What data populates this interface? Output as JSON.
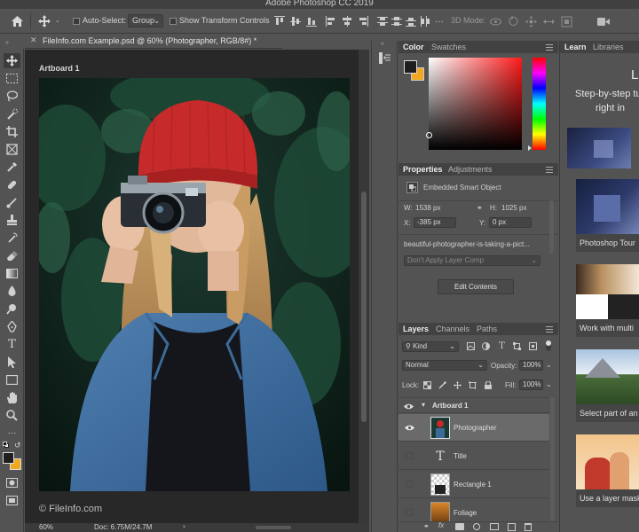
{
  "app": {
    "title": "Adobe Photoshop CC 2019"
  },
  "options_bar": {
    "auto_select_label": "Auto-Select:",
    "auto_select_value": "Group",
    "show_transform_label": "Show Transform Controls",
    "mode_3d_label": "3D Mode:"
  },
  "document": {
    "tab_title": "FileInfo.com Example.psd @ 60% (Photographer, RGB/8#) *",
    "artboard_label": "Artboard 1",
    "watermark": "© FileInfo.com",
    "zoom": "60%",
    "doc_size": "Doc: 6.75M/24.7M"
  },
  "color_panel": {
    "tabs": [
      "Color",
      "Swatches"
    ],
    "foreground": "#1e1e1e",
    "background": "#f0a820"
  },
  "properties_panel": {
    "tabs": [
      "Properties",
      "Adjustments"
    ],
    "object_type": "Embedded Smart Object",
    "w_label": "W:",
    "w_value": "1538 px",
    "h_label": "H:",
    "h_value": "1025 px",
    "x_label": "X:",
    "x_value": "-385 px",
    "y_label": "Y:",
    "y_value": "0 px",
    "filename": "beautiful-photographer-is-taking-a-pict...",
    "layer_comp": "Don't Apply Layer Comp",
    "edit_button": "Edit Contents"
  },
  "layers_panel": {
    "tabs": [
      "Layers",
      "Channels",
      "Paths"
    ],
    "filter_kind": "Kind",
    "blend_mode": "Normal",
    "opacity_label": "Opacity:",
    "opacity_value": "100%",
    "lock_label": "Lock:",
    "fill_label": "Fill:",
    "fill_value": "100%",
    "group_name": "Artboard 1",
    "layers": [
      {
        "name": "Photographer",
        "selected": true,
        "visible": true
      },
      {
        "name": "Title",
        "selected": false,
        "visible": false
      },
      {
        "name": "Rectangle 1",
        "selected": false,
        "visible": false
      },
      {
        "name": "Foliage",
        "selected": false,
        "visible": false
      }
    ]
  },
  "learn_panel": {
    "tabs": [
      "Learn",
      "Libraries"
    ],
    "intro_line1": "L",
    "intro_line2": "Step-by-step tu",
    "intro_line3": "right in",
    "cards": [
      {
        "caption": ""
      },
      {
        "caption": "Photoshop Tour"
      },
      {
        "caption": "Work with multi"
      },
      {
        "caption": "Select part of an"
      },
      {
        "caption": "Use a layer mask"
      }
    ]
  }
}
